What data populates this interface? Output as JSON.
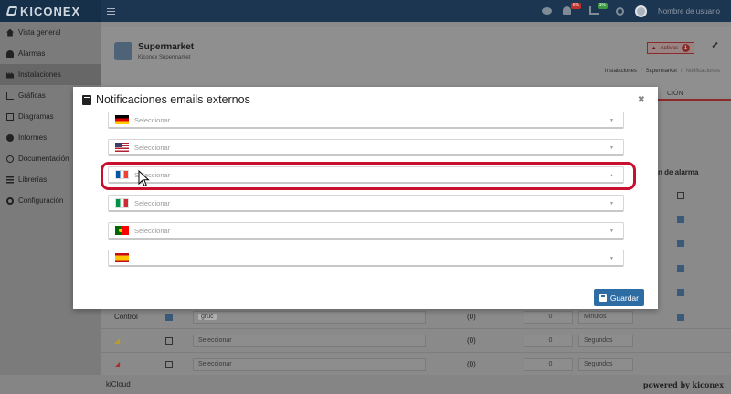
{
  "brand": {
    "name": "KICONEX"
  },
  "topbar": {
    "alerts_badge": "6%",
    "stats_badge": "1%",
    "username": "Nombre de usuario"
  },
  "sidebar": {
    "items": [
      {
        "label": "Vista general",
        "icon": "home-icon"
      },
      {
        "label": "Alarmas",
        "icon": "bell-icon"
      },
      {
        "label": "Instalaciones",
        "icon": "factory-icon",
        "active": true
      },
      {
        "label": "Gráficas",
        "icon": "line-chart-icon"
      },
      {
        "label": "Diagramas",
        "icon": "image-icon"
      },
      {
        "label": "Informes",
        "icon": "pie-chart-icon"
      },
      {
        "label": "Documentación",
        "icon": "globe-icon"
      },
      {
        "label": "Librerías",
        "icon": "list-icon"
      },
      {
        "label": "Configuración",
        "icon": "cogs-icon"
      }
    ]
  },
  "header": {
    "title": "Supermarket",
    "subtitle": "Kiconex Supermarket",
    "active_label": "Activas",
    "active_count": "1",
    "breadcrumb": [
      "Instalaciones",
      "/",
      "Supermarket",
      "/",
      "Notificaciones"
    ]
  },
  "background": {
    "tab_peek": "CIÓN",
    "column_peek": "n de alarma",
    "rows": [
      {
        "name": "Control",
        "tag": "gruc",
        "delay": "(0)",
        "value": "0",
        "unit": "Minutos"
      },
      {
        "name": "",
        "tag": "Seleccionar",
        "delay": "(0)",
        "value": "0",
        "unit": "Segundos"
      },
      {
        "name": "",
        "tag": "Seleccionar",
        "delay": "(0)",
        "value": "0",
        "unit": "Segundos"
      }
    ]
  },
  "modal": {
    "title": "Notificaciones emails externos",
    "languages": [
      {
        "flag": "de",
        "placeholder": "Seleccionar"
      },
      {
        "flag": "us",
        "placeholder": "Seleccionar"
      },
      {
        "flag": "fr",
        "placeholder": "Seleccionar"
      },
      {
        "flag": "it",
        "placeholder": "Seleccionar"
      },
      {
        "flag": "pt",
        "placeholder": "Seleccionar"
      },
      {
        "flag": "es",
        "placeholder": ""
      }
    ],
    "save_label": "Guardar",
    "highlight_color": "#c8102e"
  },
  "footer": {
    "left": "kiCloud",
    "right": "powered by kiconex"
  },
  "colors": {
    "topbar": "#1c3550",
    "accent": "#2e6da4",
    "alert": "#c8102e"
  }
}
